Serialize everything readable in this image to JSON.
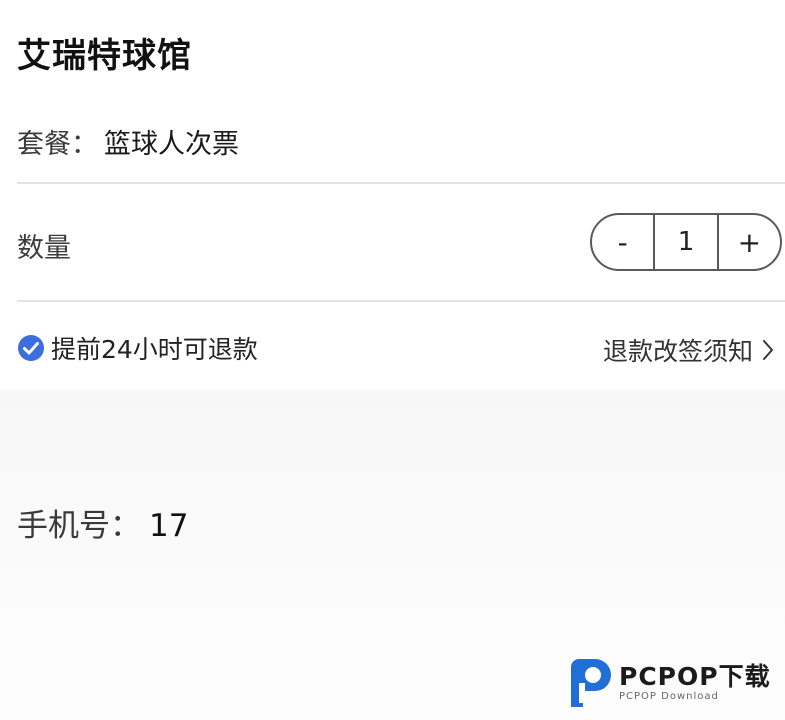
{
  "venue": {
    "title": "艾瑞特球馆"
  },
  "package": {
    "label": "套餐：",
    "value": "篮球人次票"
  },
  "quantity": {
    "label": "数量",
    "minus_label": "-",
    "value": "1",
    "plus_label": "+"
  },
  "refund": {
    "note": "提前24小时可退款",
    "policy_link": "退款改签须知",
    "check_color": "#3b6fe0"
  },
  "contact": {
    "phone_label": "手机号：",
    "phone_value": "17"
  },
  "watermark": {
    "brand": "PCPOP下载",
    "sub": "PCPOP Download",
    "logo_color": "#1f6fd6"
  }
}
